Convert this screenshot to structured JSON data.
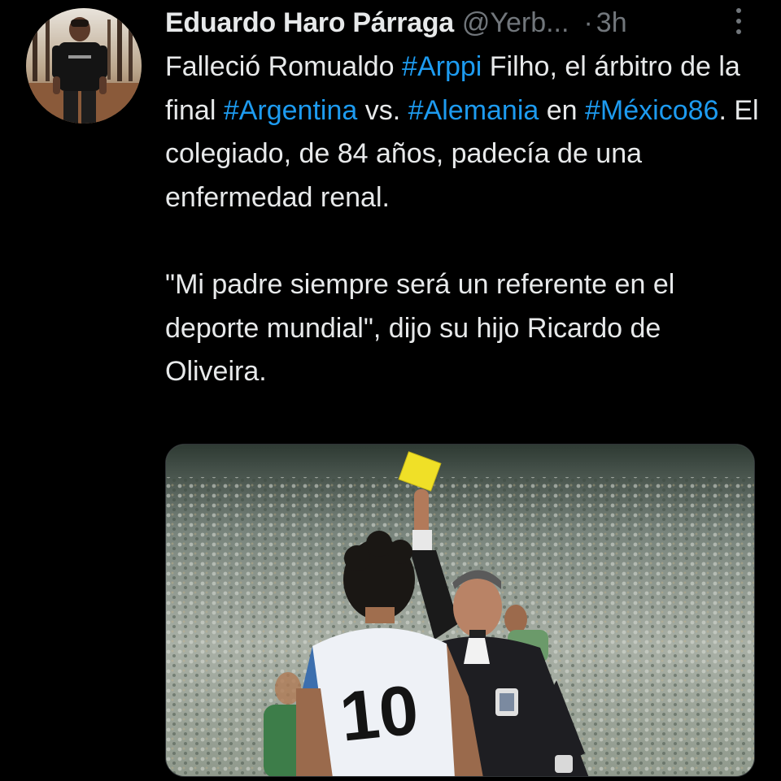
{
  "tweet": {
    "author": {
      "display_name": "Eduardo Haro Párraga",
      "handle": "@Yerb...",
      "separator": "·",
      "time": "3h"
    },
    "text": {
      "line1_a": "Falleció Romualdo ",
      "hashtag_arppi": "#Arppi",
      "line1_b": " Filho, el árbitro de la final ",
      "hashtag_argentina": "#Argentina",
      "line1_c": " vs. ",
      "hashtag_alemania": "#Alemania",
      "line1_d": " en ",
      "hashtag_mexico": "#México86",
      "line1_e": ". El colegiado, de 84 años, padecía de una enfermedad renal.",
      "quote": "\"Mi padre siempre será un referente en el deporte mundial\", dijo su hijo Ricardo de Oliveira."
    },
    "icons": {
      "more": "more-vertical-icon"
    },
    "colors": {
      "background": "#000000",
      "text": "#e7e9ea",
      "secondary": "#71767b",
      "link": "#1d9bf0"
    }
  }
}
